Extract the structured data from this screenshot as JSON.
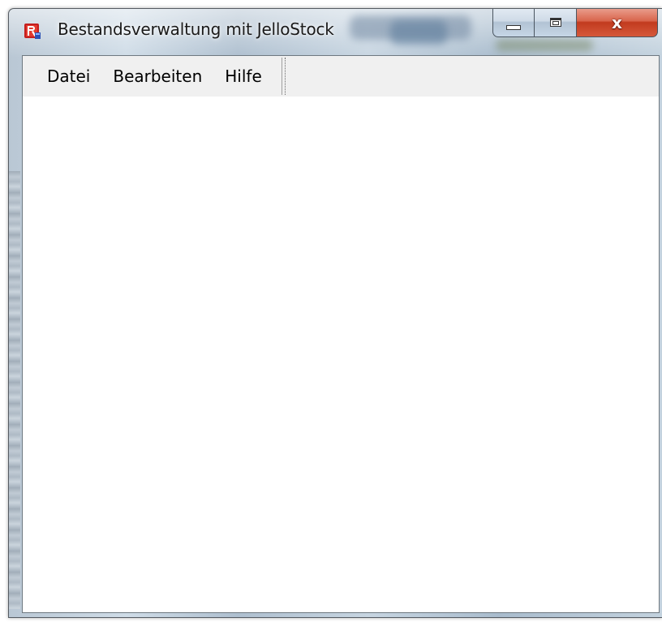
{
  "window": {
    "title": "Bestandsverwaltung mit JelloStock",
    "icon": "app-icon",
    "caption_buttons": {
      "minimize_icon": "minimize-icon",
      "maximize_icon": "maximize-icon",
      "close_label": "x"
    }
  },
  "menubar": {
    "items": [
      {
        "label": "Datei"
      },
      {
        "label": "Bearbeiten"
      },
      {
        "label": "Hilfe"
      }
    ]
  },
  "colors": {
    "close_button": "#c9442a",
    "menubar_bg": "#f0f0f0",
    "client_bg": "#ffffff"
  }
}
